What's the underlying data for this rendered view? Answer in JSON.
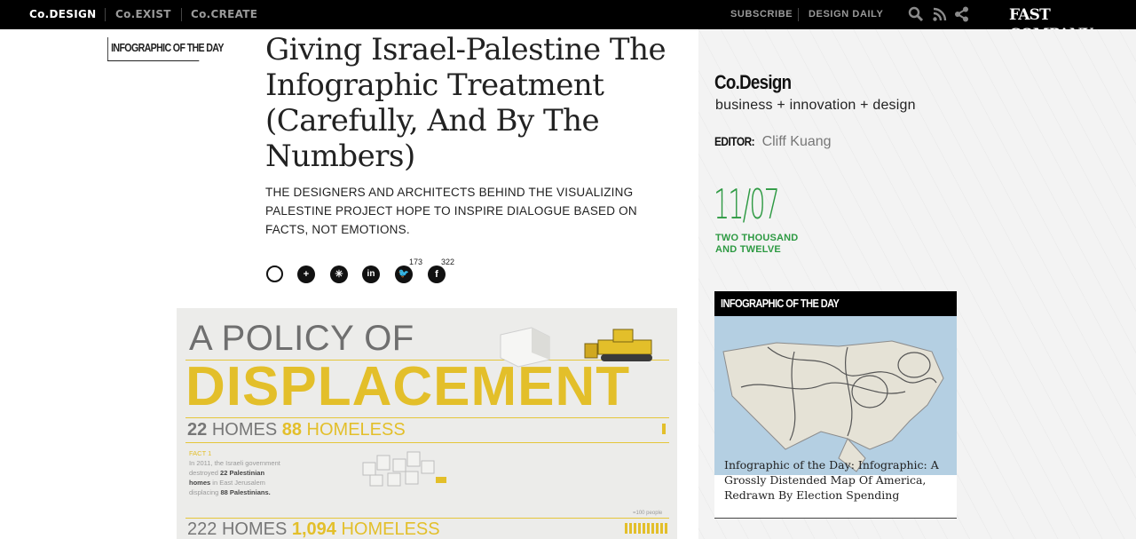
{
  "topbar": {
    "brands": [
      "Co.DESIGN",
      "Co.EXIST",
      "Co.CREATE"
    ],
    "subscribe": "SUBSCRIBE",
    "design_daily": "DESIGN DAILY",
    "logo": "FAST COMPANY",
    "icons": [
      "search-icon",
      "rss-icon",
      "share-icon"
    ]
  },
  "article": {
    "kicker": "INFOGRAPHIC OF THE DAY",
    "title": "Giving Israel-Palestine The Infographic Treatment (Carefully, And By The Numbers)",
    "dek": "The designers and architects behind the Visualizing Palestine project hope to inspire dialogue based on facts, not emotions.",
    "share": {
      "twitter_count": "173",
      "facebook_count": "322"
    }
  },
  "infographic": {
    "line1": "A POLICY OF",
    "line2": "DISPLACEMENT",
    "stat1_homes": "22",
    "stat1_homes_label": "HOMES",
    "stat1_homeless": "88",
    "stat1_homeless_label": "HOMELESS",
    "fact_head": "FACT 1",
    "fact_text_1": "In 2011, the Israeli government destroyed",
    "fact_bold_1": "22 Palestinian homes",
    "fact_text_2": "in East Jerusalem displacing",
    "fact_bold_2": "88 Palestinians.",
    "legend": "=100 people",
    "stat2_homes": "222",
    "stat2_homes_label": "HOMES",
    "stat2_homeless": "1,094",
    "stat2_homeless_label": "HOMELESS"
  },
  "sidebar": {
    "title": "Co.Design",
    "tagline": "business + innovation + design",
    "editor_label": "EDITOR:",
    "editor_name": "Cliff Kuang",
    "date": "11/07",
    "year_line1": "TWO THOUSAND",
    "year_line2": "AND TWELVE",
    "card_head": "INFOGRAPHIC OF THE DAY",
    "card_caption": "Infographic of the Day: Infographic: A Grossly Distended Map Of America, Redrawn By Election Spending"
  },
  "colors": {
    "topbar_bg": "#000000",
    "accent_green": "#2e9a43",
    "infographic_yellow": "#e3bf2a",
    "sidebar_bg": "#f3f3f3"
  }
}
